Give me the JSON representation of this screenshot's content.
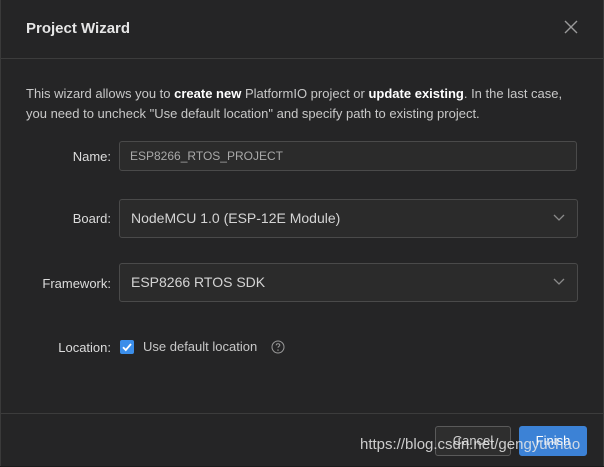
{
  "dialog": {
    "title": "Project Wizard",
    "close_glyph": "X"
  },
  "description": {
    "part1": "This wizard allows you to ",
    "bold1": "create new",
    "part2": " PlatformIO project or ",
    "bold2": "update existing",
    "part3": ". In the last case, you need to uncheck \"Use default location\" and specify path to existing project."
  },
  "form": {
    "name_label": "Name:",
    "name_value": "ESP8266_RTOS_PROJECT",
    "board_label": "Board:",
    "board_value": "NodeMCU 1.0 (ESP-12E Module)",
    "framework_label": "Framework:",
    "framework_value": "ESP8266 RTOS SDK",
    "location_label": "Location:",
    "use_default_location_label": "Use default location",
    "use_default_location_checked": true
  },
  "footer": {
    "cancel_label": "Cancel",
    "finish_label": "Finish"
  },
  "watermark": "https://blog.csdn.net/gengyuchao",
  "icons": {
    "close": "close-icon",
    "chevron": "chevron-down-icon",
    "check": "check-icon",
    "help": "help-icon"
  },
  "colors": {
    "background": "#252526",
    "accent": "#3c82d6",
    "checkbox": "#3b8eea"
  }
}
